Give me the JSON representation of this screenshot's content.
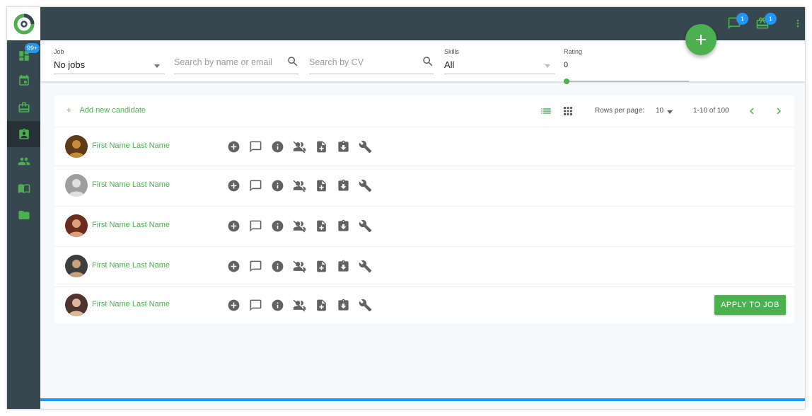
{
  "sidebar": {
    "dashboard_badge": "99+",
    "items": [
      {
        "icon": "dashboard-icon"
      },
      {
        "icon": "calendar-icon"
      },
      {
        "icon": "briefcase-icon"
      },
      {
        "icon": "candidates-icon",
        "active": true
      },
      {
        "icon": "people-icon"
      },
      {
        "icon": "book-icon"
      },
      {
        "icon": "folder-icon"
      }
    ]
  },
  "topbar": {
    "messages_badge": "1",
    "gifts_badge": "1"
  },
  "filters": {
    "job": {
      "label": "Job",
      "value": "No jobs"
    },
    "search_name": {
      "placeholder": "Search by name or email"
    },
    "search_cv": {
      "placeholder": "Search by CV"
    },
    "skills": {
      "label": "Skills",
      "value": "All"
    },
    "rating": {
      "label": "Rating",
      "value": "0"
    }
  },
  "list": {
    "add_candidate_label": "Add new candidate",
    "rows_per_page_label": "Rows per page:",
    "rows_per_page_value": "10",
    "range_text": "1-10 of 100",
    "apply_label": "APPLY TO JOB",
    "candidates": [
      {
        "name": "First Name Last Name"
      },
      {
        "name": "First Name Last Name"
      },
      {
        "name": "First Name Last Name"
      },
      {
        "name": "First Name Last Name"
      },
      {
        "name": "First Name Last Name"
      }
    ],
    "row_actions": [
      "add-circle-icon",
      "comment-icon",
      "info-icon",
      "person-off-icon",
      "note-add-icon",
      "assignment-returned-icon",
      "wrench-icon"
    ]
  },
  "colors": {
    "accent": "#4caf50",
    "sidebar": "#37474f",
    "badge": "#2196f3"
  }
}
